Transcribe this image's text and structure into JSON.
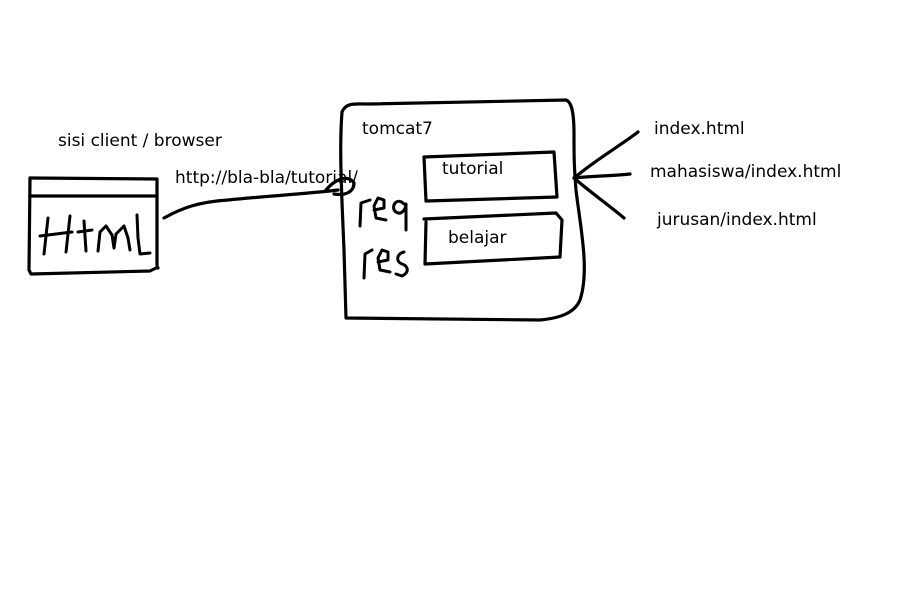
{
  "labels": {
    "client_side": "sisi client / browser",
    "request_url": "http://bla-bla/tutorial/",
    "server": "tomcat7",
    "app_tutorial": "tutorial",
    "app_belajar": "belajar",
    "file_index": "index.html",
    "file_mahasiswa": "mahasiswa/index.html",
    "file_jurusan": "jurusan/index.html"
  },
  "handwritten": {
    "browser_content": "Html",
    "server_note": "req res"
  },
  "colors": {
    "background": "#ffffff",
    "ink": "#000000"
  }
}
